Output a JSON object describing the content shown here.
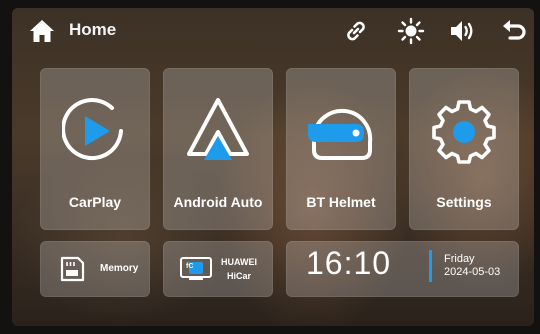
{
  "header": {
    "home_label": "Home",
    "icons": [
      "home-icon",
      "link-icon",
      "brightness-icon",
      "volume-icon",
      "back-icon"
    ]
  },
  "apps": [
    {
      "label": "CarPlay",
      "icon": "carplay-icon"
    },
    {
      "label": "Android Auto",
      "icon": "android-auto-icon"
    },
    {
      "label": "BT Helmet",
      "icon": "helmet-icon"
    },
    {
      "label": "Settings",
      "icon": "gear-icon"
    }
  ],
  "shortcuts": {
    "memory_label": "Memory",
    "hicar_line1": "HUAWEI",
    "hicar_line2": "HiCar",
    "hicar_badge": "fC"
  },
  "clock": {
    "time": "16:10",
    "day": "Friday",
    "date": "2024-05-03"
  },
  "colors": {
    "accent": "#1e9bea",
    "icon_white": "#ffffff",
    "tile_bg": "rgba(255,255,255,0.22)"
  }
}
